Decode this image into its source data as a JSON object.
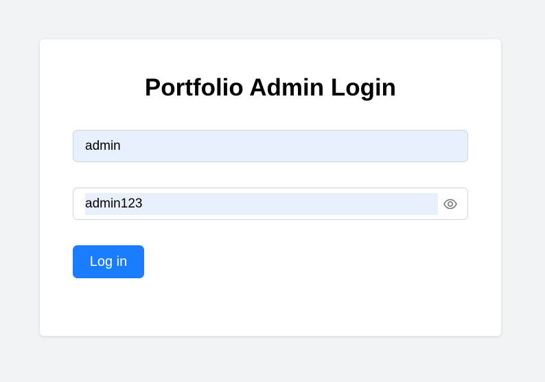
{
  "login": {
    "title": "Portfolio Admin Login",
    "username_value": "admin",
    "password_value": "admin123",
    "button_label": "Log in"
  },
  "icons": {
    "password_toggle": "eye-icon"
  },
  "colors": {
    "page_background": "#f2f3f5",
    "card_background": "#ffffff",
    "autofill_background": "#e8f0fe",
    "input_border": "#cfd4da",
    "primary_button": "#1a7cff",
    "button_text": "#ffffff",
    "icon_gray": "#777777"
  }
}
